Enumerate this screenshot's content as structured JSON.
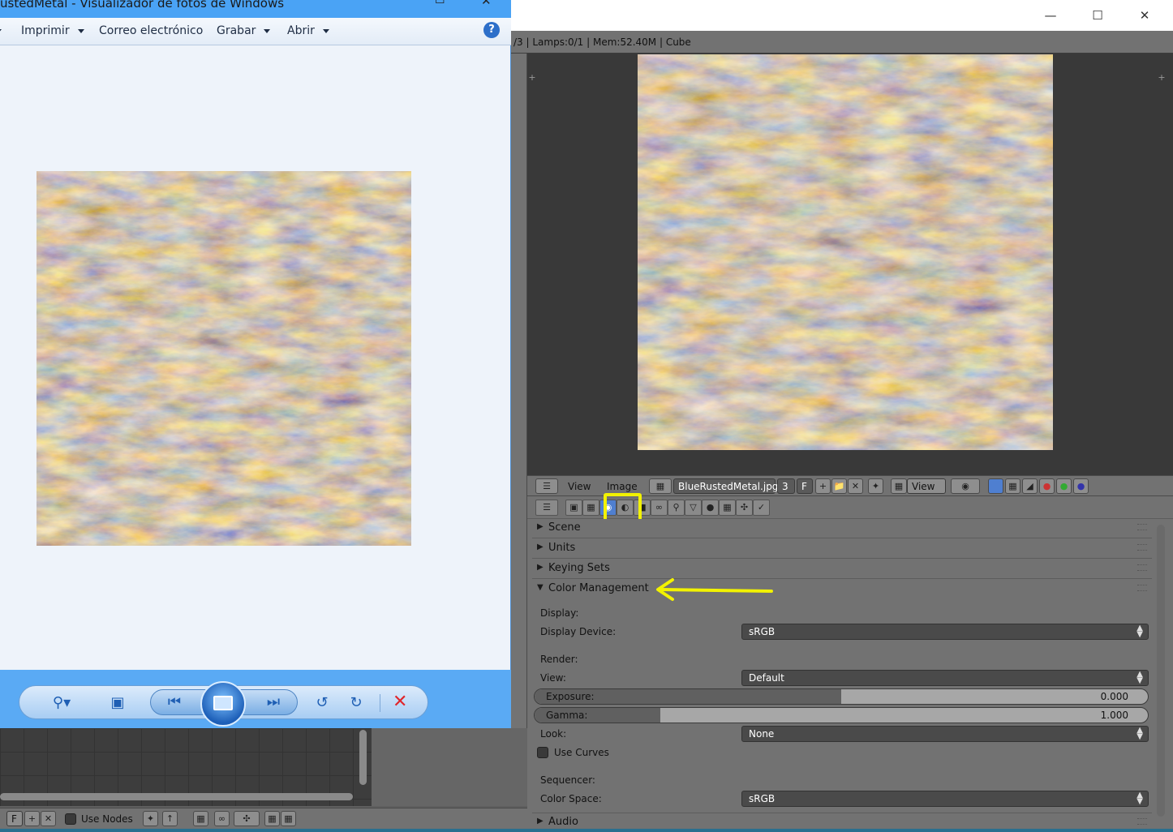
{
  "photo_viewer": {
    "title": "ustedMetal - Visualizador de fotos de Windows",
    "menu": [
      "Imprimir",
      "Correo electrónico",
      "Grabar",
      "Abrir"
    ],
    "help_label": "?",
    "toolbar": {
      "zoom_icon": "zoom-icon",
      "fit_icon": "fit-window-icon",
      "prev_icon": "previous-icon",
      "slideshow_icon": "slideshow-icon",
      "next_icon": "next-icon",
      "rotate_ccw_icon": "rotate-counterclockwise-icon",
      "rotate_cw_icon": "rotate-clockwise-icon",
      "delete_icon": "delete-icon"
    }
  },
  "blender": {
    "info_bar": "/3 | Lamps:0/1 | Mem:52.40M | Cube",
    "image_header": {
      "view_menu": "View",
      "image_menu": "Image",
      "image_name": "BlueRustedMetal.jpg",
      "users": "3",
      "fake_user": "F",
      "display_mode": "View"
    },
    "panels": {
      "scene": "Scene",
      "units": "Units",
      "keying_sets": "Keying Sets",
      "color_management": "Color Management",
      "audio": "Audio"
    },
    "color_management": {
      "display_heading": "Display:",
      "display_device_label": "Display Device:",
      "display_device_value": "sRGB",
      "render_heading": "Render:",
      "view_label": "View:",
      "view_value": "Default",
      "exposure_label": "Exposure:",
      "exposure_value": "0.000",
      "gamma_label": "Gamma:",
      "gamma_value": "1.000",
      "look_label": "Look:",
      "look_value": "None",
      "use_curves_label": "Use Curves",
      "sequencer_heading": "Sequencer:",
      "color_space_label": "Color Space:",
      "color_space_value": "sRGB"
    },
    "node_header": {
      "fake_user": "F",
      "use_nodes_label": "Use Nodes"
    }
  },
  "colors": {
    "highlight": "#f2f200",
    "blender_panel": "#727272",
    "viewer_toolbar": "#5aaaf4"
  }
}
